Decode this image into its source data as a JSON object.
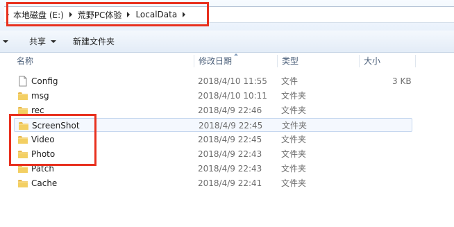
{
  "address_bar": {
    "crumbs": [
      {
        "label": "本地磁盘 (E:)"
      },
      {
        "label": "荒野PC体验"
      },
      {
        "label": "LocalData"
      }
    ]
  },
  "command_bar": {
    "share_label": "共享",
    "new_folder_label": "新建文件夹"
  },
  "columns": {
    "name": "名称",
    "modified": "修改日期",
    "type": "类型",
    "size": "大小"
  },
  "files": [
    {
      "name": "Config",
      "date": "2018/4/10 11:55",
      "type": "文件",
      "size": "3 KB",
      "icon": "file-icon"
    },
    {
      "name": "msg",
      "date": "2018/4/10 10:11",
      "type": "文件夹",
      "size": "",
      "icon": "folder-icon"
    },
    {
      "name": "rec",
      "date": "2018/4/9 22:46",
      "type": "文件夹",
      "size": "",
      "icon": "folder-icon"
    },
    {
      "name": "ScreenShot",
      "date": "2018/4/9 22:45",
      "type": "文件夹",
      "size": "",
      "icon": "folder-icon"
    },
    {
      "name": "Video",
      "date": "2018/4/9 22:45",
      "type": "文件夹",
      "size": "",
      "icon": "folder-icon"
    },
    {
      "name": "Photo",
      "date": "2018/4/9 22:43",
      "type": "文件夹",
      "size": "",
      "icon": "folder-icon"
    },
    {
      "name": "Patch",
      "date": "2018/4/9 22:43",
      "type": "文件夹",
      "size": "",
      "icon": "folder-icon"
    },
    {
      "name": "Cache",
      "date": "2018/4/9 22:41",
      "type": "文件夹",
      "size": "",
      "icon": "folder-icon"
    }
  ],
  "hovered_row": "ScreenShot",
  "colors": {
    "annotation_red": "#e8301e",
    "folder_yellow": "#f3cf63",
    "hover_row_bg": "#f4f8fe"
  }
}
